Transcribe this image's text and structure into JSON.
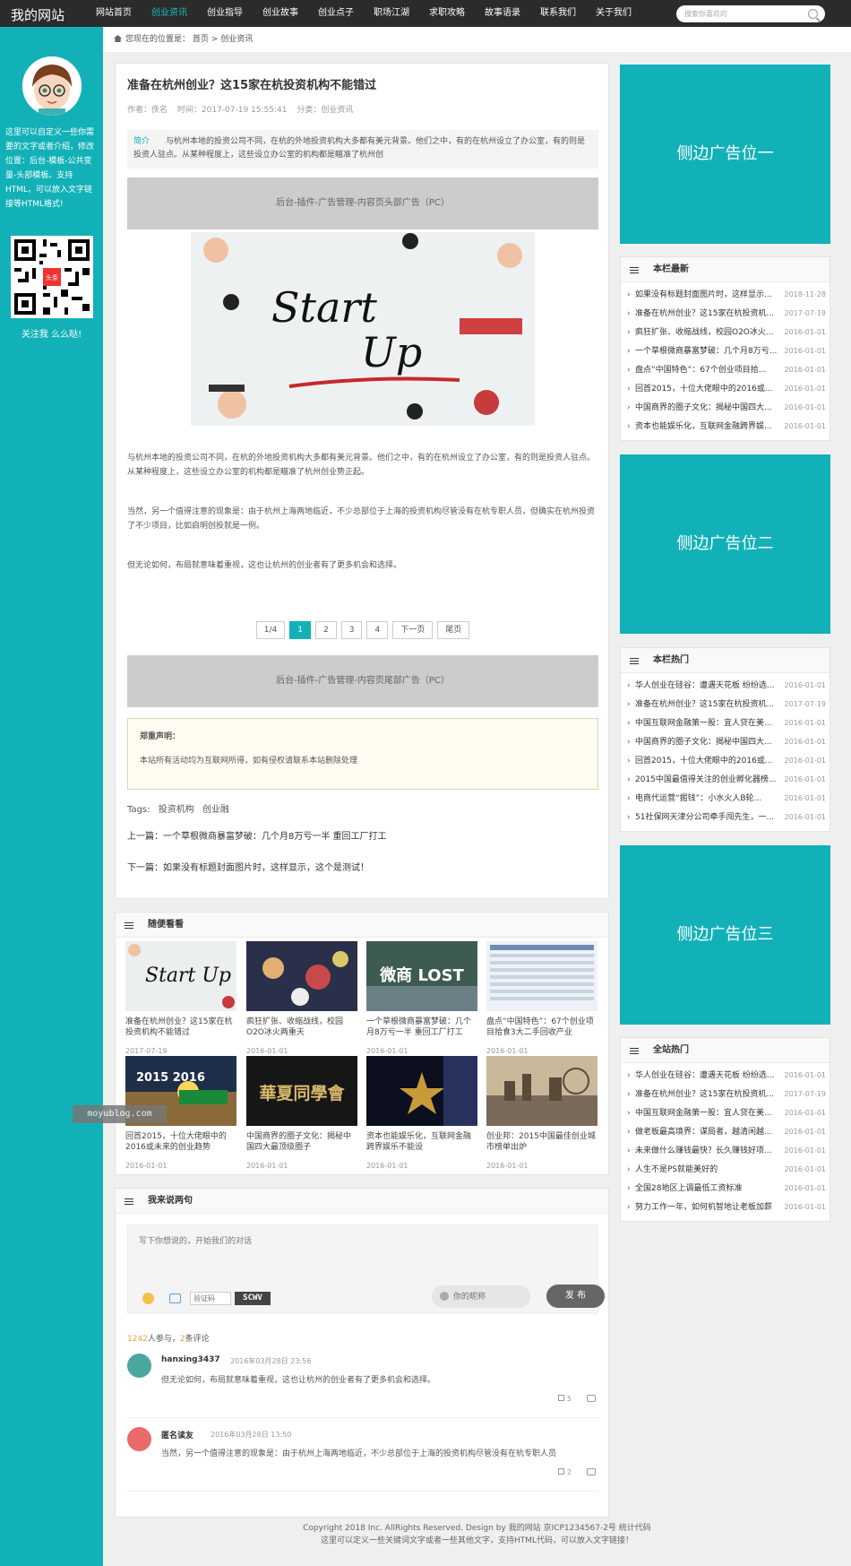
{
  "site": {
    "logo": "我的网站"
  },
  "nav": [
    {
      "label": "网站首页",
      "active": false
    },
    {
      "label": "创业资讯",
      "active": true
    },
    {
      "label": "创业指导",
      "active": false
    },
    {
      "label": "创业故事",
      "active": false
    },
    {
      "label": "创业点子",
      "active": false
    },
    {
      "label": "职场江湖",
      "active": false
    },
    {
      "label": "求职攻略",
      "active": false
    },
    {
      "label": "故事语录",
      "active": false
    },
    {
      "label": "联系我们",
      "active": false
    },
    {
      "label": "关于我们",
      "active": false
    }
  ],
  "search": {
    "placeholder": "搜索你喜欢的"
  },
  "leftbar": {
    "intro": "这里可以自定义一些你需要的文字或者介绍，修改位置：后台-模板-公共变量-头部模板。支持HTML，可以放入文字链接等HTML格式!",
    "qr_badge": "头条",
    "follow": "关注我 么么哒!"
  },
  "breadcrumb": {
    "prefix": "您现在的位置是：",
    "home": "首页",
    "sep": ">",
    "current": "创业资讯"
  },
  "article": {
    "title": "准备在杭州创业？这15家在杭投资机构不能错过",
    "author": "作者：佚名",
    "time": "时间：2017-07-19 15:55:41",
    "category": "分类：创业资讯",
    "summary_label": "简介",
    "summary": "与杭州本地的投资公司不同，在杭的外地投资机构大多都有美元背景。他们之中，有的在杭州设立了办公室，有的则是投资人驻点。从某种程度上，这些设立办公室的机构都是瞄准了杭州创",
    "ad_top": "后台-插件-广告管理-内容页头部广告（PC）",
    "paragraphs": [
      "与杭州本地的投资公司不同，在杭的外地投资机构大多都有美元背景。他们之中，有的在杭州设立了办公室，有的则是投资人驻点。从某种程度上，这些设立办公室的机构都是瞄准了杭州创业势正起。",
      "当然，另一个值得注意的现象是：由于杭州上海两地临近，不少总部位于上海的投资机构尽管没有在杭专职人员，但确实在杭州投资了不少项目，比如启明创投就是一例。",
      "但无论如何，布局就意味着重视，这也让杭州的创业者有了更多机会和选择。"
    ],
    "pager": [
      "1/4",
      "1",
      "2",
      "3",
      "4",
      "下一页",
      "尾页"
    ],
    "ad_bottom": "后台-插件-广告管理-内容页尾部广告（PC）",
    "notice_title": "郑重声明：",
    "notice_text": "本站所有活动均为互联网所得，如有侵权请联系本站删除处理",
    "tags_label": "Tags:",
    "tags": [
      "投资机构",
      "创业融"
    ],
    "prev": "上一篇：一个草根微商暴富梦破：几个月8万亏一半 重回工厂打工",
    "next": "下一篇：如果没有标题封面图片时，这样显示，这个是测试！"
  },
  "hero_image": {
    "line1": "Start",
    "line2": "Up"
  },
  "random": {
    "title": "随便看看",
    "items": [
      {
        "title": "准备在杭州创业？这15家在杭投资机构不能错过",
        "date": "2017-07-19",
        "thumb_text": "Start Up"
      },
      {
        "title": "疯狂扩张、收缩战线，校园O2O冰火两重天",
        "date": "2016-01-01",
        "thumb_text": ""
      },
      {
        "title": "一个草根微商暴富梦破：几个月8万亏一半 重回工厂打工",
        "date": "2016-01-01",
        "thumb_text": "微商 LOST"
      },
      {
        "title": "盘点“中国特色”：67个创业项目拾食3大二手回收产业",
        "date": "2016-01-01",
        "thumb_text": ""
      },
      {
        "title": "回首2015，十位大佬眼中的2016或未来的创业趋势",
        "date": "2016-01-01",
        "thumb_text": "2015 2016"
      },
      {
        "title": "中国商界的圈子文化：揭秘中国四大最顶级圈子",
        "date": "2016-01-01",
        "thumb_text": "華夏同學會"
      },
      {
        "title": "资本也能娱乐化，互联网金融跨界娱乐不能设",
        "date": "2016-01-01",
        "thumb_text": ""
      },
      {
        "title": "创业邦：2015中国最佳创业城市榜单出炉",
        "date": "2016-01-01",
        "thumb_text": ""
      }
    ]
  },
  "watermark": "moyublog.com",
  "comments": {
    "title": "我来说两句",
    "placeholder": "写下你想说的，开始我们的对话",
    "captcha_placeholder": "验证码",
    "captcha_code": "SCWV",
    "nick_placeholder": "你的昵称",
    "publish": "发 布",
    "participants": "1242",
    "participants_label": "人参与，",
    "count": "2",
    "count_label": "条评论",
    "list": [
      {
        "user": "hanxing3437",
        "time": "2016年03月28日 23:56",
        "text": "但无论如何，布局就意味着重视，这也让杭州的创业者有了更多机会和选择。",
        "likes": "5",
        "color": "#4aa7a0"
      },
      {
        "user": "匿名读友",
        "time": "2016年03月28日 13:50",
        "text": "当然，另一个值得注意的现象是：由于杭州上海两地临近，不少总部位于上海的投资机构尽管没有在杭专职人员",
        "likes": "2",
        "color": "#e86a6a"
      }
    ]
  },
  "side": {
    "ad1": "侧边广告位一",
    "ad2": "侧边广告位二",
    "ad3": "侧边广告位三",
    "latest": {
      "title": "本栏最新",
      "items": [
        {
          "t": "如果没有标题封面图片时，这样显示...",
          "d": "2018-11-28"
        },
        {
          "t": "准备在杭州创业？这15家在杭投资机...",
          "d": "2017-07-19"
        },
        {
          "t": "疯狂扩张、收缩战线，校园O2O冰火...",
          "d": "2016-01-01"
        },
        {
          "t": "一个草根微商暴富梦破：几个月8万亏...",
          "d": "2016-01-01"
        },
        {
          "t": "盘点“中国特色”：67个创业项目拾...",
          "d": "2016-01-01"
        },
        {
          "t": "回首2015，十位大佬眼中的2016或...",
          "d": "2016-01-01"
        },
        {
          "t": "中国商界的圈子文化：揭秘中国四大...",
          "d": "2016-01-01"
        },
        {
          "t": "资本也能娱乐化，互联网金融跨界娱...",
          "d": "2016-01-01"
        }
      ]
    },
    "hot": {
      "title": "本栏热门",
      "items": [
        {
          "t": "华人创业在硅谷：遭遇天花板 纷纷选...",
          "d": "2016-01-01"
        },
        {
          "t": "准备在杭州创业？这15家在杭投资机...",
          "d": "2017-07-19"
        },
        {
          "t": "中国互联网金融第一股：宜人贷在美...",
          "d": "2016-01-01"
        },
        {
          "t": "中国商界的圈子文化：揭秘中国四大...",
          "d": "2016-01-01"
        },
        {
          "t": "回首2015，十位大佬眼中的2016或...",
          "d": "2016-01-01"
        },
        {
          "t": "2015中国最值得关注的创业孵化器榜...",
          "d": "2016-01-01"
        },
        {
          "t": "电商代运营“掘钱”：小水火人B轮...",
          "d": "2016-01-01"
        },
        {
          "t": "51社保网天津分公司牵手闯先生，一...",
          "d": "2016-01-01"
        }
      ]
    },
    "sitehot": {
      "title": "全站热门",
      "items": [
        {
          "t": "华人创业在硅谷：遭遇天花板 纷纷选...",
          "d": "2016-01-01"
        },
        {
          "t": "准备在杭州创业？这15家在杭投资机...",
          "d": "2017-07-19"
        },
        {
          "t": "中国互联网金融第一股：宜人贷在美...",
          "d": "2016-01-01"
        },
        {
          "t": "做老板最高境界：谋局者，越清闲越...",
          "d": "2016-01-01"
        },
        {
          "t": "未来做什么赚钱最快？长久赚钱好项...",
          "d": "2016-01-01"
        },
        {
          "t": "人生不是PS就能美好的",
          "d": "2016-01-01"
        },
        {
          "t": "全国28地区上调最低工资标准",
          "d": "2016-01-01"
        },
        {
          "t": "努力工作一年，如何机智地让老板加薪",
          "d": "2016-01-01"
        }
      ]
    }
  },
  "footer": {
    "line1": "Copyright 2018 Inc. AllRights Reserved. Design by 我的网站 京ICP1234567-2号 统计代码",
    "line2": "这里可以定义一些关键词文字或者一些其他文字，支持HTML代码，可以放入文字链接！"
  }
}
